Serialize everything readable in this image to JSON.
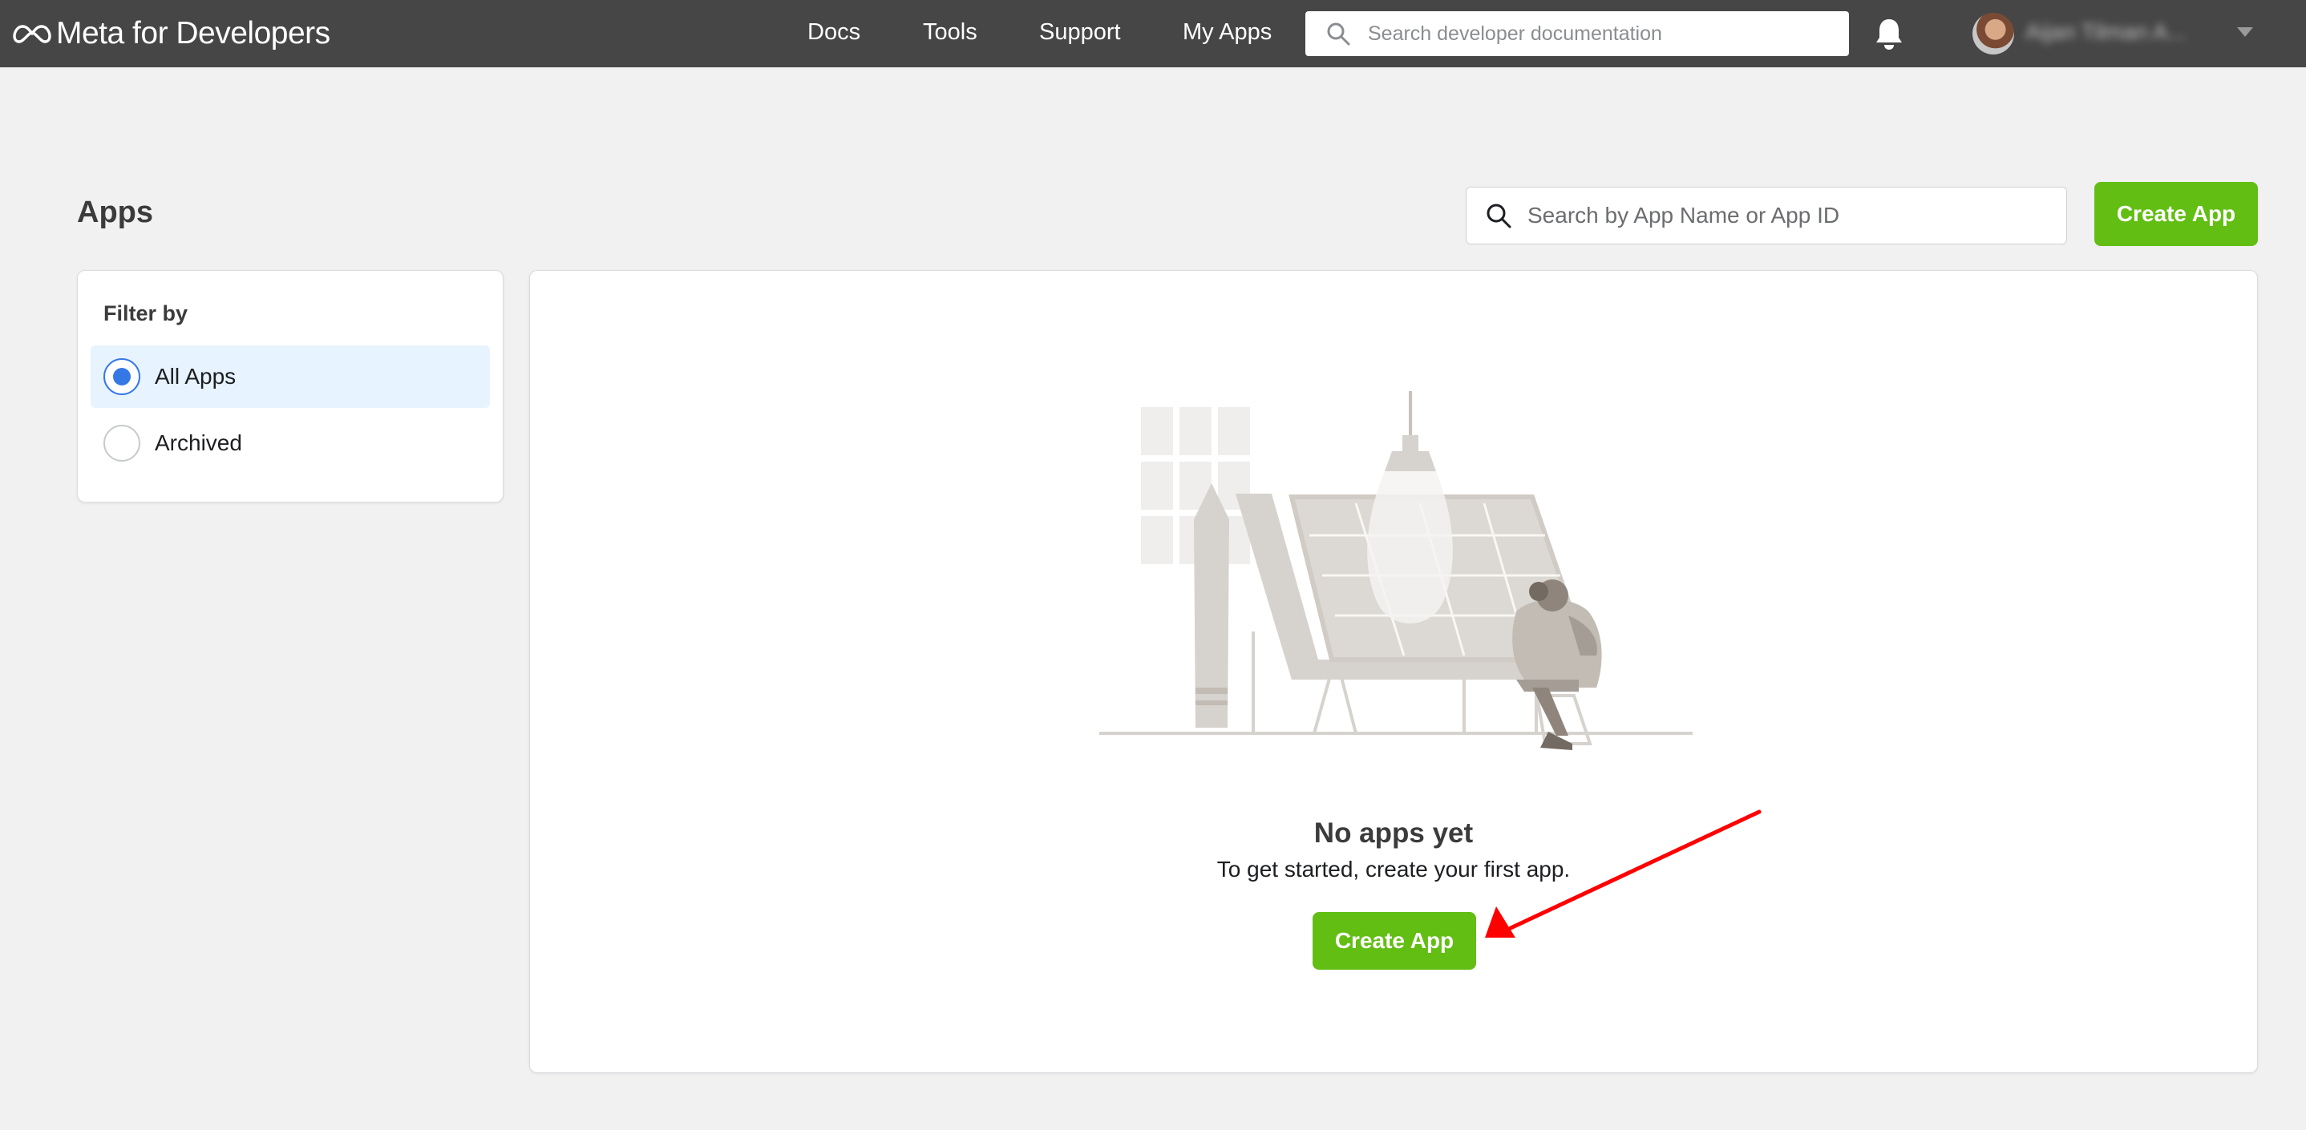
{
  "header": {
    "brand": "Meta for Developers",
    "nav": [
      "Docs",
      "Tools",
      "Support",
      "My Apps"
    ],
    "search_placeholder": "Search developer documentation",
    "user_name": "Aijan Tilman A..."
  },
  "page": {
    "title": "Apps",
    "search_placeholder": "Search by App Name or App ID",
    "create_label": "Create App"
  },
  "filter": {
    "title": "Filter by",
    "options": [
      {
        "label": "All Apps",
        "selected": true
      },
      {
        "label": "Archived",
        "selected": false
      }
    ]
  },
  "empty_state": {
    "title": "No apps yet",
    "subtitle": "To get started, create your first app.",
    "button": "Create App"
  },
  "colors": {
    "topbar": "#464646",
    "accent_green": "#62be13",
    "radio_blue": "#3578e5",
    "annotation_red": "#ff0000"
  },
  "icons": [
    "meta-logo-icon",
    "search-icon",
    "bell-icon",
    "chevron-down-icon",
    "red-arrow"
  ]
}
